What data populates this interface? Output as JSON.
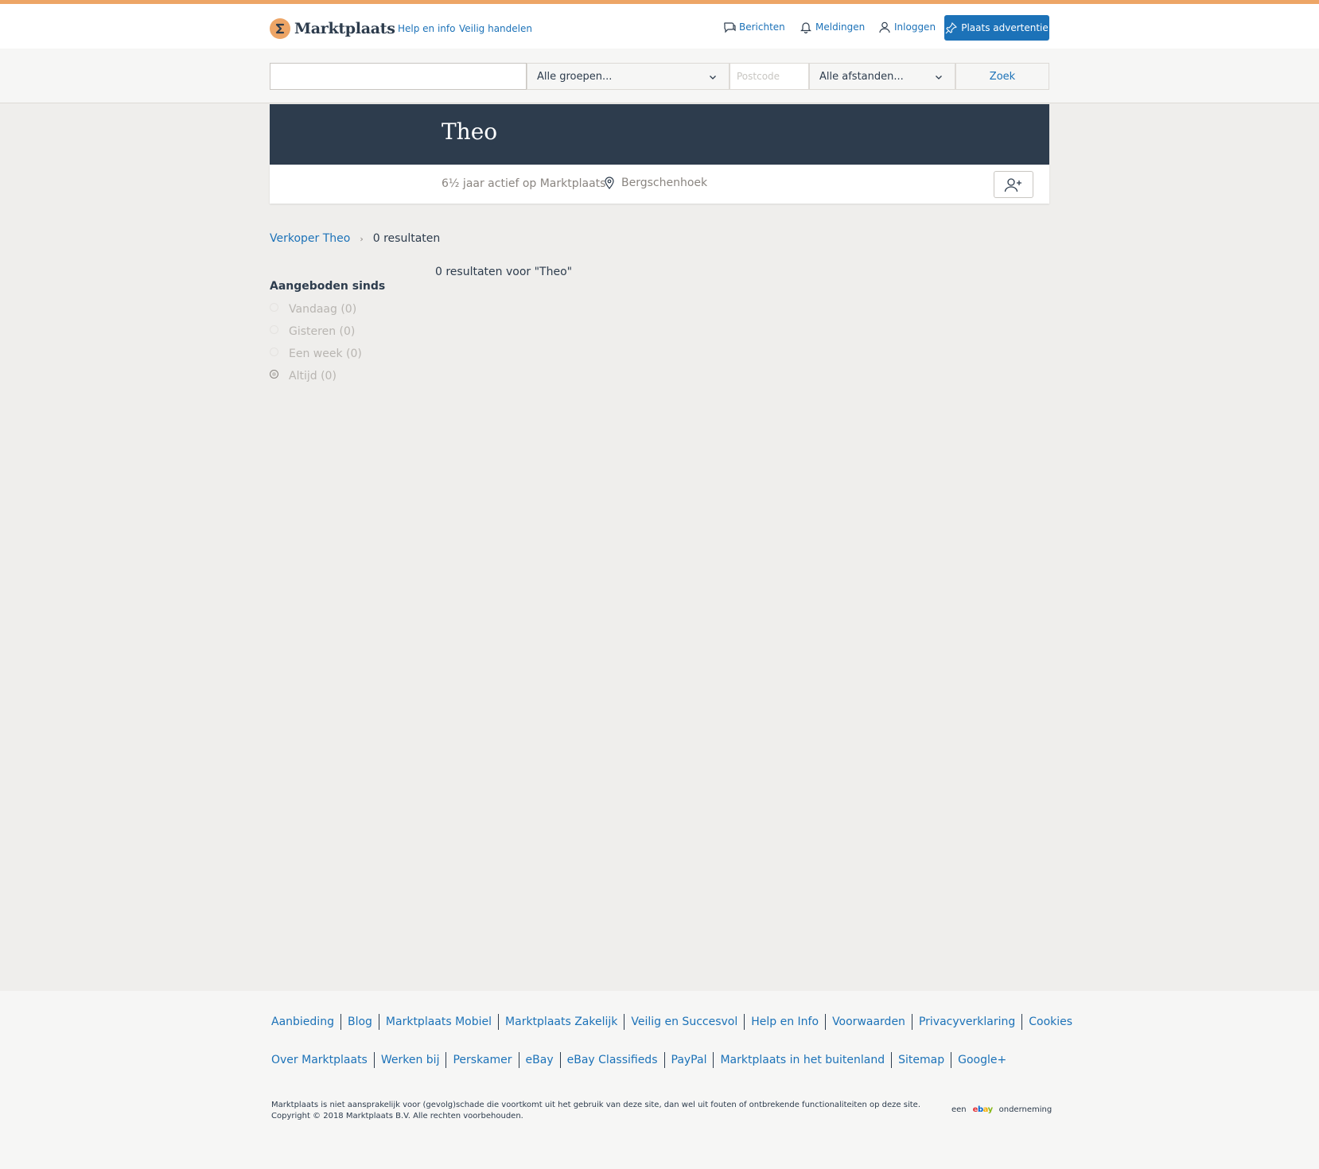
{
  "header": {
    "logo_text": "Marktplaats",
    "nav": {
      "help": "Help en info",
      "safe": "Veilig handelen"
    },
    "links": {
      "messages": "Berichten",
      "notifications": "Meldingen",
      "login": "Inloggen"
    },
    "post_ad": "Plaats advertentie"
  },
  "search": {
    "query_value": "",
    "groups_selected": "Alle groepen...",
    "postcode_placeholder": "Postcode",
    "distance_selected": "Alle afstanden...",
    "submit": "Zoek"
  },
  "profile": {
    "name": "Theo",
    "active": "6½ jaar actief op Marktplaats",
    "location": "Bergschenhoek"
  },
  "breadcrumb": {
    "seller": "Verkoper Theo",
    "current": "0 resultaten"
  },
  "results": {
    "label": "0 resultaten voor \"Theo\""
  },
  "filters": {
    "title": "Aangeboden sinds",
    "options": [
      {
        "label": "Vandaag (0)",
        "checked": false
      },
      {
        "label": "Gisteren (0)",
        "checked": false
      },
      {
        "label": "Een week (0)",
        "checked": false
      },
      {
        "label": "Altijd (0)",
        "checked": true
      }
    ]
  },
  "footer": {
    "row1": [
      "Aanbieding",
      "Blog",
      "Marktplaats Mobiel",
      "Marktplaats Zakelijk",
      "Veilig en Succesvol",
      "Help en Info",
      "Voorwaarden",
      "Privacyverklaring",
      "Cookies"
    ],
    "row2": [
      "Over Marktplaats",
      "Werken bij",
      "Perskamer",
      "eBay",
      "eBay Classifieds",
      "PayPal",
      "Marktplaats in het buitenland",
      "Sitemap",
      "Google+"
    ],
    "disclaimer_line1": "Marktplaats is niet aansprakelijk voor (gevolg)schade die voortkomt uit het gebruik van deze site, dan wel uit fouten of ontbrekende functionaliteiten op deze site.",
    "disclaimer_line2": "Copyright © 2018 Marktplaats B.V. Alle rechten voorbehouden.",
    "ebay_prefix": "een",
    "ebay_logo": "ebay",
    "ebay_suffix": "onderneming"
  },
  "colors": {
    "accent": "#eda566",
    "link": "#1c72b8",
    "banner": "#2d3c4d",
    "page_bg": "#efeeec"
  }
}
